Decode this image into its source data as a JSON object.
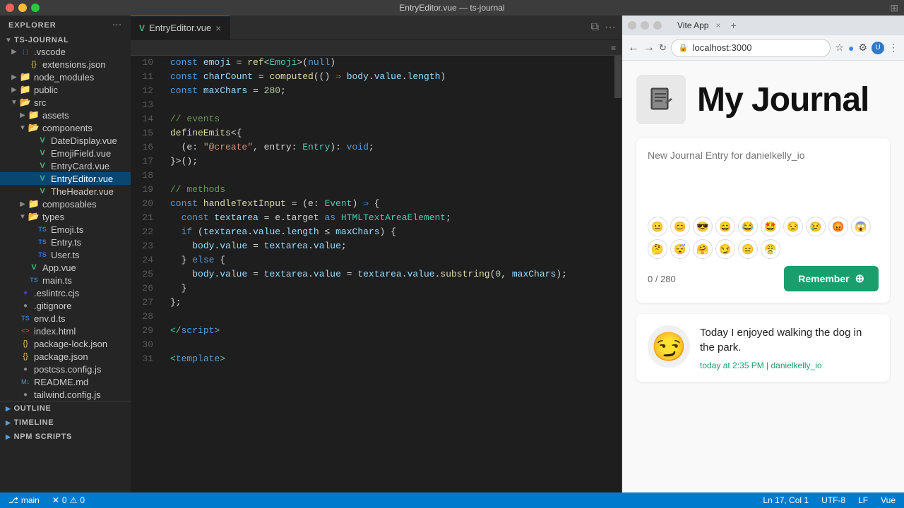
{
  "titleBar": {
    "title": "EntryEditor.vue — ts-journal",
    "layoutIcon": "⊞"
  },
  "sidebar": {
    "header": "Explorer",
    "rootLabel": "TS-JOURNAL",
    "tree": [
      {
        "id": "vscode",
        "indent": 1,
        "arrow": "▶",
        "icon": "📁",
        "iconClass": "icon-vscode",
        "label": ".vscode",
        "type": "folder"
      },
      {
        "id": "extensions-json",
        "indent": 2,
        "arrow": "",
        "icon": "{}",
        "iconClass": "icon-json",
        "label": "extensions.json",
        "type": "file"
      },
      {
        "id": "node_modules",
        "indent": 1,
        "arrow": "▶",
        "icon": "📁",
        "iconClass": "icon-folder",
        "label": "node_modules",
        "type": "folder"
      },
      {
        "id": "public",
        "indent": 1,
        "arrow": "▶",
        "icon": "📁",
        "iconClass": "icon-folder",
        "label": "public",
        "type": "folder"
      },
      {
        "id": "src",
        "indent": 1,
        "arrow": "▼",
        "icon": "📂",
        "iconClass": "icon-folder-open",
        "label": "src",
        "type": "folder-open"
      },
      {
        "id": "assets",
        "indent": 2,
        "arrow": "▶",
        "icon": "📁",
        "iconClass": "icon-folder",
        "label": "assets",
        "type": "folder"
      },
      {
        "id": "components",
        "indent": 2,
        "arrow": "▼",
        "icon": "📂",
        "iconClass": "icon-folder-open",
        "label": "components",
        "type": "folder-open"
      },
      {
        "id": "DateDisplay-vue",
        "indent": 3,
        "arrow": "",
        "icon": "V",
        "iconClass": "icon-vue",
        "label": "DateDisplay.vue",
        "type": "file"
      },
      {
        "id": "EmojiField-vue",
        "indent": 3,
        "arrow": "",
        "icon": "V",
        "iconClass": "icon-vue",
        "label": "EmojiField.vue",
        "type": "file"
      },
      {
        "id": "EntryCard-vue",
        "indent": 3,
        "arrow": "",
        "icon": "V",
        "iconClass": "icon-vue",
        "label": "EntryCard.vue",
        "type": "file"
      },
      {
        "id": "EntryEditor-vue",
        "indent": 3,
        "arrow": "",
        "icon": "V",
        "iconClass": "icon-vue",
        "label": "EntryEditor.vue",
        "type": "file",
        "active": true
      },
      {
        "id": "TheHeader-vue",
        "indent": 3,
        "arrow": "",
        "icon": "V",
        "iconClass": "icon-vue",
        "label": "TheHeader.vue",
        "type": "file"
      },
      {
        "id": "composables",
        "indent": 2,
        "arrow": "▶",
        "icon": "📁",
        "iconClass": "icon-folder",
        "label": "composables",
        "type": "folder"
      },
      {
        "id": "types",
        "indent": 2,
        "arrow": "▼",
        "icon": "📂",
        "iconClass": "icon-folder-open",
        "label": "types",
        "type": "folder-open"
      },
      {
        "id": "Emoji-ts",
        "indent": 3,
        "arrow": "",
        "icon": "TS",
        "iconClass": "icon-ts",
        "label": "Emoji.ts",
        "type": "file"
      },
      {
        "id": "Entry-ts",
        "indent": 3,
        "arrow": "",
        "icon": "TS",
        "iconClass": "icon-ts",
        "label": "Entry.ts",
        "type": "file"
      },
      {
        "id": "User-ts",
        "indent": 3,
        "arrow": "",
        "icon": "TS",
        "iconClass": "icon-ts",
        "label": "User.ts",
        "type": "file"
      },
      {
        "id": "App-vue",
        "indent": 2,
        "arrow": "",
        "icon": "V",
        "iconClass": "icon-vue",
        "label": "App.vue",
        "type": "file"
      },
      {
        "id": "main-ts",
        "indent": 2,
        "arrow": "",
        "icon": "TS",
        "iconClass": "icon-ts",
        "label": "main.ts",
        "type": "file"
      },
      {
        "id": "eslintrc-cjs",
        "indent": 1,
        "arrow": "",
        "icon": "●",
        "iconClass": "icon-eslint",
        "label": ".eslintrc.cjs",
        "type": "file"
      },
      {
        "id": "gitignore",
        "indent": 1,
        "arrow": "",
        "icon": "◌",
        "iconClass": "",
        "label": ".gitignore",
        "type": "file"
      },
      {
        "id": "env-d-ts",
        "indent": 1,
        "arrow": "",
        "icon": "TS",
        "iconClass": "icon-ts",
        "label": "env.d.ts",
        "type": "file"
      },
      {
        "id": "index-html",
        "indent": 1,
        "arrow": "",
        "icon": "<>",
        "iconClass": "icon-html",
        "label": "index.html",
        "type": "file"
      },
      {
        "id": "package-lock-json",
        "indent": 1,
        "arrow": "",
        "icon": "{}",
        "iconClass": "icon-json",
        "label": "package-lock.json",
        "type": "file"
      },
      {
        "id": "package-json",
        "indent": 1,
        "arrow": "",
        "icon": "{}",
        "iconClass": "icon-json",
        "label": "package.json",
        "type": "file"
      },
      {
        "id": "postcss-config-js",
        "indent": 1,
        "arrow": "",
        "icon": "●",
        "iconClass": "",
        "label": "postcss.config.js",
        "type": "file"
      },
      {
        "id": "README-md",
        "indent": 1,
        "arrow": "",
        "icon": "M↓",
        "iconClass": "icon-md",
        "label": "README.md",
        "type": "file"
      },
      {
        "id": "tailwind-config-js",
        "indent": 1,
        "arrow": "",
        "icon": "~",
        "iconClass": "",
        "label": "tailwind.config.js",
        "type": "file"
      }
    ],
    "bottomSections": [
      {
        "id": "outline",
        "label": "OUTLINE"
      },
      {
        "id": "timeline",
        "label": "TIMELINE"
      },
      {
        "id": "npm-scripts",
        "label": "NPM SCRIPTS"
      }
    ]
  },
  "editor": {
    "tabLabel": "EntryEditor.vue",
    "lines": [
      {
        "num": 10,
        "tokens": [
          {
            "t": "const ",
            "c": "kw"
          },
          {
            "t": "emoji",
            "c": "var"
          },
          {
            "t": " = ",
            "c": "op"
          },
          {
            "t": "ref",
            "c": "fn"
          },
          {
            "t": "<",
            "c": "op"
          },
          {
            "t": "Emoji",
            "c": "type"
          },
          {
            "t": ">(",
            "c": "op"
          },
          {
            "t": "null",
            "c": "kw"
          },
          {
            "t": ")",
            "c": "op"
          }
        ]
      },
      {
        "num": 11,
        "tokens": [
          {
            "t": "const ",
            "c": "kw"
          },
          {
            "t": "charCount",
            "c": "var"
          },
          {
            "t": " = ",
            "c": "op"
          },
          {
            "t": "computed",
            "c": "fn"
          },
          {
            "t": "(()",
            "c": "op"
          },
          {
            "t": " ⇒ ",
            "c": "arrow"
          },
          {
            "t": "body",
            "c": "var"
          },
          {
            "t": ".",
            "c": "op"
          },
          {
            "t": "value",
            "c": "var"
          },
          {
            "t": ".",
            "c": "op"
          },
          {
            "t": "length",
            "c": "var"
          },
          {
            "t": ")",
            "c": "op"
          }
        ]
      },
      {
        "num": 12,
        "tokens": [
          {
            "t": "const ",
            "c": "kw"
          },
          {
            "t": "maxChars",
            "c": "var"
          },
          {
            "t": " = ",
            "c": "op"
          },
          {
            "t": "280",
            "c": "num"
          },
          {
            "t": ";",
            "c": "op"
          }
        ]
      },
      {
        "num": 13,
        "tokens": []
      },
      {
        "num": 14,
        "tokens": [
          {
            "t": "// events",
            "c": "cm"
          }
        ]
      },
      {
        "num": 15,
        "tokens": [
          {
            "t": "defineEmits",
            "c": "fn"
          },
          {
            "t": "<{",
            "c": "op"
          }
        ]
      },
      {
        "num": 16,
        "tokens": [
          {
            "t": "  (e: ",
            "c": "op"
          },
          {
            "t": "\"@create\"",
            "c": "str"
          },
          {
            "t": ", entry: ",
            "c": "op"
          },
          {
            "t": "Entry",
            "c": "type"
          },
          {
            "t": "): ",
            "c": "op"
          },
          {
            "t": "void",
            "c": "kw"
          },
          {
            "t": ";",
            "c": "op"
          }
        ]
      },
      {
        "num": 17,
        "tokens": [
          {
            "t": "}>",
            "c": "op"
          },
          {
            "t": "()",
            "c": "op"
          },
          {
            "t": ";",
            "c": "op"
          }
        ]
      },
      {
        "num": 18,
        "tokens": []
      },
      {
        "num": 19,
        "tokens": [
          {
            "t": "// methods",
            "c": "cm"
          }
        ]
      },
      {
        "num": 20,
        "tokens": [
          {
            "t": "const ",
            "c": "kw"
          },
          {
            "t": "handleTextInput",
            "c": "fn"
          },
          {
            "t": " = (e: ",
            "c": "op"
          },
          {
            "t": "Event",
            "c": "type"
          },
          {
            "t": ")",
            "c": "op"
          },
          {
            "t": " ⇒ ",
            "c": "arrow"
          },
          {
            "t": "{",
            "c": "op"
          }
        ]
      },
      {
        "num": 21,
        "tokens": [
          {
            "t": "  const ",
            "c": "kw"
          },
          {
            "t": "textarea",
            "c": "var"
          },
          {
            "t": " = e.target ",
            "c": "op"
          },
          {
            "t": "as ",
            "c": "kw"
          },
          {
            "t": "HTMLTextAreaElement",
            "c": "type"
          },
          {
            "t": ";",
            "c": "op"
          }
        ]
      },
      {
        "num": 22,
        "tokens": [
          {
            "t": "  if ",
            "c": "kw"
          },
          {
            "t": "(",
            "c": "op"
          },
          {
            "t": "textarea",
            "c": "var"
          },
          {
            "t": ".",
            "c": "op"
          },
          {
            "t": "value",
            "c": "var"
          },
          {
            "t": ".",
            "c": "op"
          },
          {
            "t": "length ",
            "c": "var"
          },
          {
            "t": "≤ ",
            "c": "op"
          },
          {
            "t": "maxChars",
            "c": "var"
          },
          {
            "t": ") {",
            "c": "op"
          }
        ]
      },
      {
        "num": 23,
        "tokens": [
          {
            "t": "    ",
            "c": "op"
          },
          {
            "t": "body",
            "c": "var"
          },
          {
            "t": ".",
            "c": "op"
          },
          {
            "t": "value",
            "c": "var"
          },
          {
            "t": " = ",
            "c": "op"
          },
          {
            "t": "textarea",
            "c": "var"
          },
          {
            "t": ".",
            "c": "op"
          },
          {
            "t": "value",
            "c": "var"
          },
          {
            "t": ";",
            "c": "op"
          }
        ]
      },
      {
        "num": 24,
        "tokens": [
          {
            "t": "  } ",
            "c": "op"
          },
          {
            "t": "else ",
            "c": "kw"
          },
          {
            "t": "{",
            "c": "op"
          }
        ]
      },
      {
        "num": 25,
        "tokens": [
          {
            "t": "    ",
            "c": "op"
          },
          {
            "t": "body",
            "c": "var"
          },
          {
            "t": ".",
            "c": "op"
          },
          {
            "t": "value",
            "c": "var"
          },
          {
            "t": " = ",
            "c": "op"
          },
          {
            "t": "textarea",
            "c": "var"
          },
          {
            "t": ".",
            "c": "op"
          },
          {
            "t": "value",
            "c": "var"
          },
          {
            "t": " = ",
            "c": "op"
          },
          {
            "t": "textarea",
            "c": "var"
          },
          {
            "t": ".",
            "c": "op"
          },
          {
            "t": "value",
            "c": "var"
          },
          {
            "t": ".",
            "c": "op"
          },
          {
            "t": "substring",
            "c": "fn"
          },
          {
            "t": "(",
            "c": "op"
          },
          {
            "t": "0",
            "c": "num"
          },
          {
            "t": ", ",
            "c": "op"
          },
          {
            "t": "maxChars",
            "c": "var"
          },
          {
            "t": ");",
            "c": "op"
          }
        ]
      },
      {
        "num": 26,
        "tokens": [
          {
            "t": "  }",
            "c": "op"
          }
        ]
      },
      {
        "num": 27,
        "tokens": [
          {
            "t": "};",
            "c": "op"
          }
        ]
      },
      {
        "num": 28,
        "tokens": []
      },
      {
        "num": 29,
        "tokens": [
          {
            "t": "</",
            "c": "tag"
          },
          {
            "t": "script",
            "c": "kw"
          },
          {
            "t": ">",
            "c": "tag"
          }
        ]
      },
      {
        "num": 30,
        "tokens": []
      },
      {
        "num": 31,
        "tokens": [
          {
            "t": "<",
            "c": "tag"
          },
          {
            "t": "template",
            "c": "kw"
          },
          {
            "t": ">",
            "c": "tag"
          }
        ]
      }
    ]
  },
  "browser": {
    "url": "localhost:3000",
    "tabTitle": "Vite App",
    "app": {
      "title": "My Journal",
      "form": {
        "placeholder": "New Journal Entry for danielkelly_io",
        "charCount": "0",
        "maxChars": "280",
        "charCountLabel": "0 / 280",
        "submitLabel": "Remember",
        "submitIcon": "⊕",
        "emojis": [
          "😐",
          "😊",
          "😎",
          "😄",
          "😂",
          "🤩",
          "😒",
          "😢",
          "😡",
          "😱",
          "🤔",
          "😴",
          "🤗",
          "😏",
          "😑",
          "😤"
        ]
      },
      "entries": [
        {
          "emoji": "😏",
          "text": "Today I enjoyed walking the dog in the park.",
          "meta": "today at 2:35 PM | danielkelly_io"
        }
      ]
    }
  },
  "statusBar": {
    "branch": "main",
    "errors": "0",
    "warnings": "0",
    "encoding": "UTF-8",
    "lineEnding": "LF",
    "language": "Vue",
    "position": "Ln 17, Col 1"
  }
}
